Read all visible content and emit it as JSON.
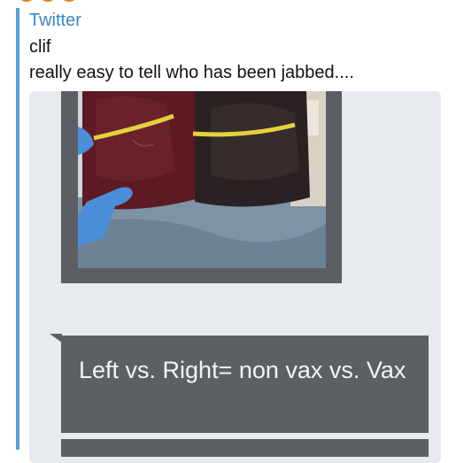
{
  "preview": {
    "site_name": "Twitter",
    "author": "clif",
    "text": "really easy to tell who has been jabbed....",
    "image": {
      "caption": "Left vs. Right= non vax vs. Vax"
    }
  },
  "colors": {
    "site_name": "#3a87c8",
    "accent_bar": "#5aa0d8",
    "card_background": "#e7eaee",
    "bubble_background": "#5c5f63"
  },
  "icons": [
    "emoji-icon"
  ]
}
